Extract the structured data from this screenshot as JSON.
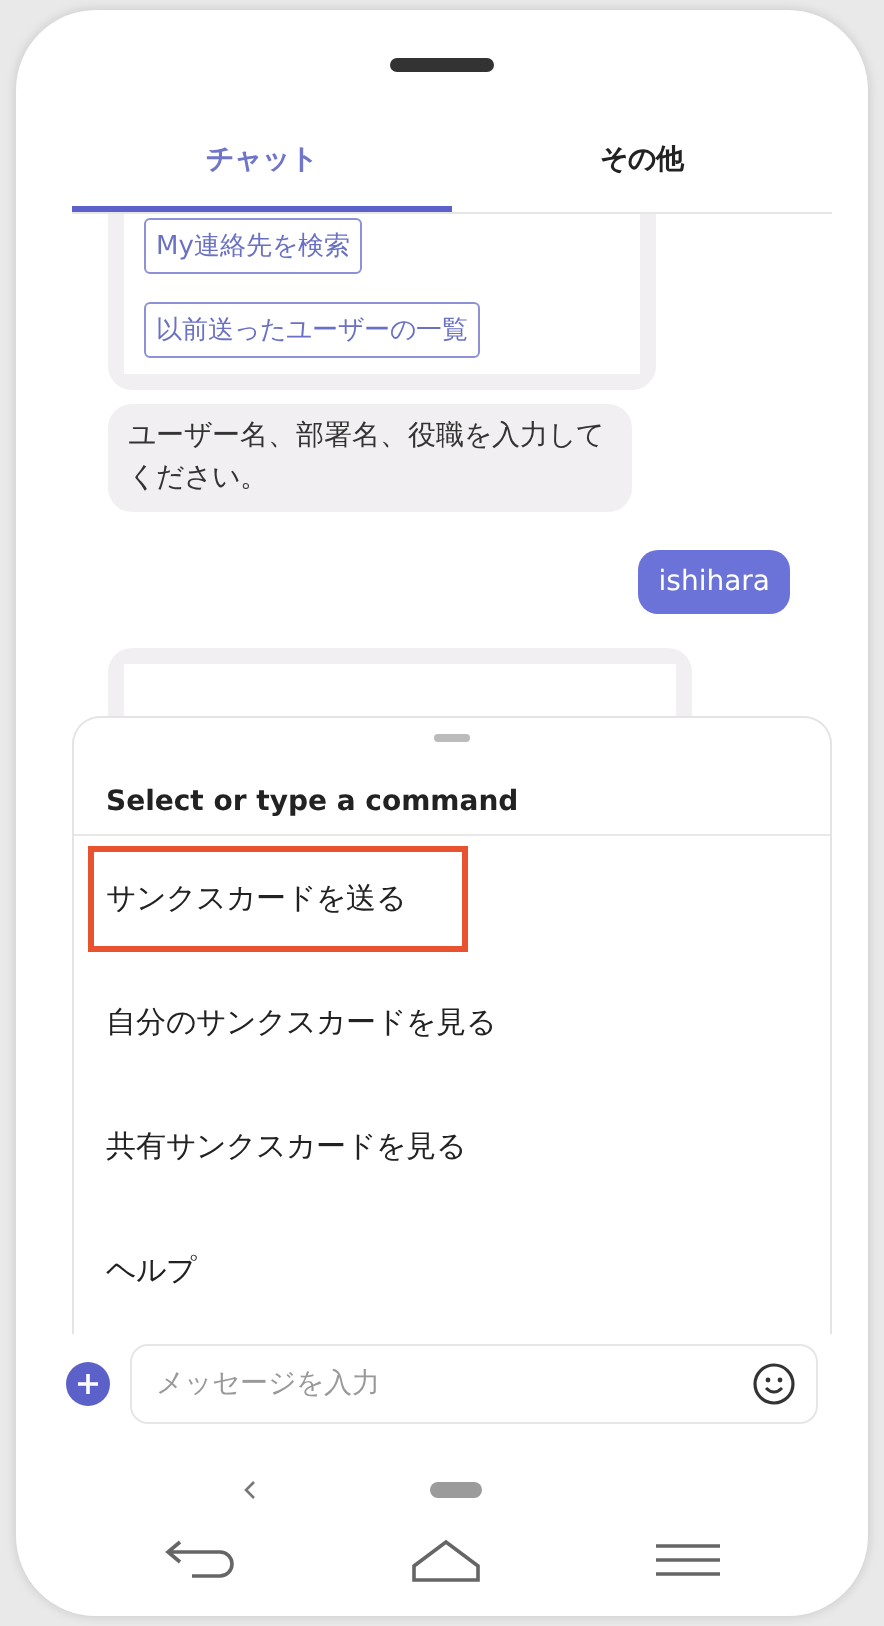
{
  "tabs": [
    {
      "label": "チャット",
      "selected": true
    },
    {
      "label": "その他",
      "selected": false
    }
  ],
  "messages": [
    {
      "kind": "buttons",
      "buttons": [
        "My連絡先を検索",
        "以前送ったユーザーの一覧"
      ]
    },
    {
      "kind": "bot",
      "text": "ユーザー名、部署名、役職を入力してください。"
    },
    {
      "kind": "user",
      "text": "ishihara"
    },
    {
      "kind": "card"
    }
  ],
  "command_sheet": {
    "title": "Select or type a command",
    "commands": [
      {
        "label": "サンクスカードを送る",
        "highlighted": true
      },
      {
        "label": "自分のサンクスカードを見る",
        "highlighted": false
      },
      {
        "label": "共有サンクスカードを見る",
        "highlighted": false
      },
      {
        "label": "ヘルプ",
        "highlighted": false
      }
    ]
  },
  "composer": {
    "placeholder": "メッセージを入力"
  }
}
